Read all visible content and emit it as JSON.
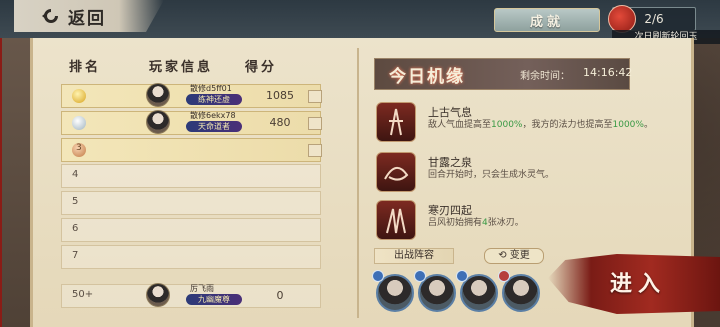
{
  "topbar": {
    "back_label": "返回",
    "achievement_label": "成就",
    "counter": "2/6",
    "refresh_note": "次日刷新轮回玉"
  },
  "ranking": {
    "headers": {
      "rank": "排名",
      "player": "玩家信息",
      "score": "得分"
    },
    "rows": [
      {
        "rank": "1",
        "name": "散修d5ff01",
        "title": "练神还虚",
        "score": "1085",
        "tier": "gold"
      },
      {
        "rank": "2",
        "name": "散修6ekx78",
        "title": "天命道者",
        "score": "480",
        "tier": "silver"
      },
      {
        "rank": "3",
        "name": "",
        "title": "",
        "score": "",
        "tier": "bronze"
      },
      {
        "rank": "4"
      },
      {
        "rank": "5"
      },
      {
        "rank": "6"
      },
      {
        "rank": "7"
      }
    ],
    "self_row": {
      "rank": "50+",
      "name": "厉飞雨",
      "title": "九幽魔尊",
      "score": "0"
    }
  },
  "daily": {
    "title": "今日机缘",
    "timer_label": "剩余时间：",
    "timer_value": "14:16:42",
    "buffs": [
      {
        "name": "上古气息",
        "desc_prefix": "敌人气血提高至",
        "pct1": "1000%",
        "desc_mid": "，我方的法力也提高至",
        "pct2": "1000%",
        "desc_suffix": "。"
      },
      {
        "name": "甘露之泉",
        "desc": "回合开始时，只会生成水灵气。"
      },
      {
        "name": "寒刃四起",
        "desc_prefix": "吕风初始拥有",
        "count": "4",
        "desc_suffix": "张冰刃。"
      }
    ]
  },
  "lineup": {
    "label": "出战阵容",
    "change_label": "变更",
    "enter_label": "进入"
  },
  "colors": {
    "accent_red": "#a12a20",
    "highlight_green": "#3a9a45",
    "panel_brown": "#5d4a40"
  }
}
